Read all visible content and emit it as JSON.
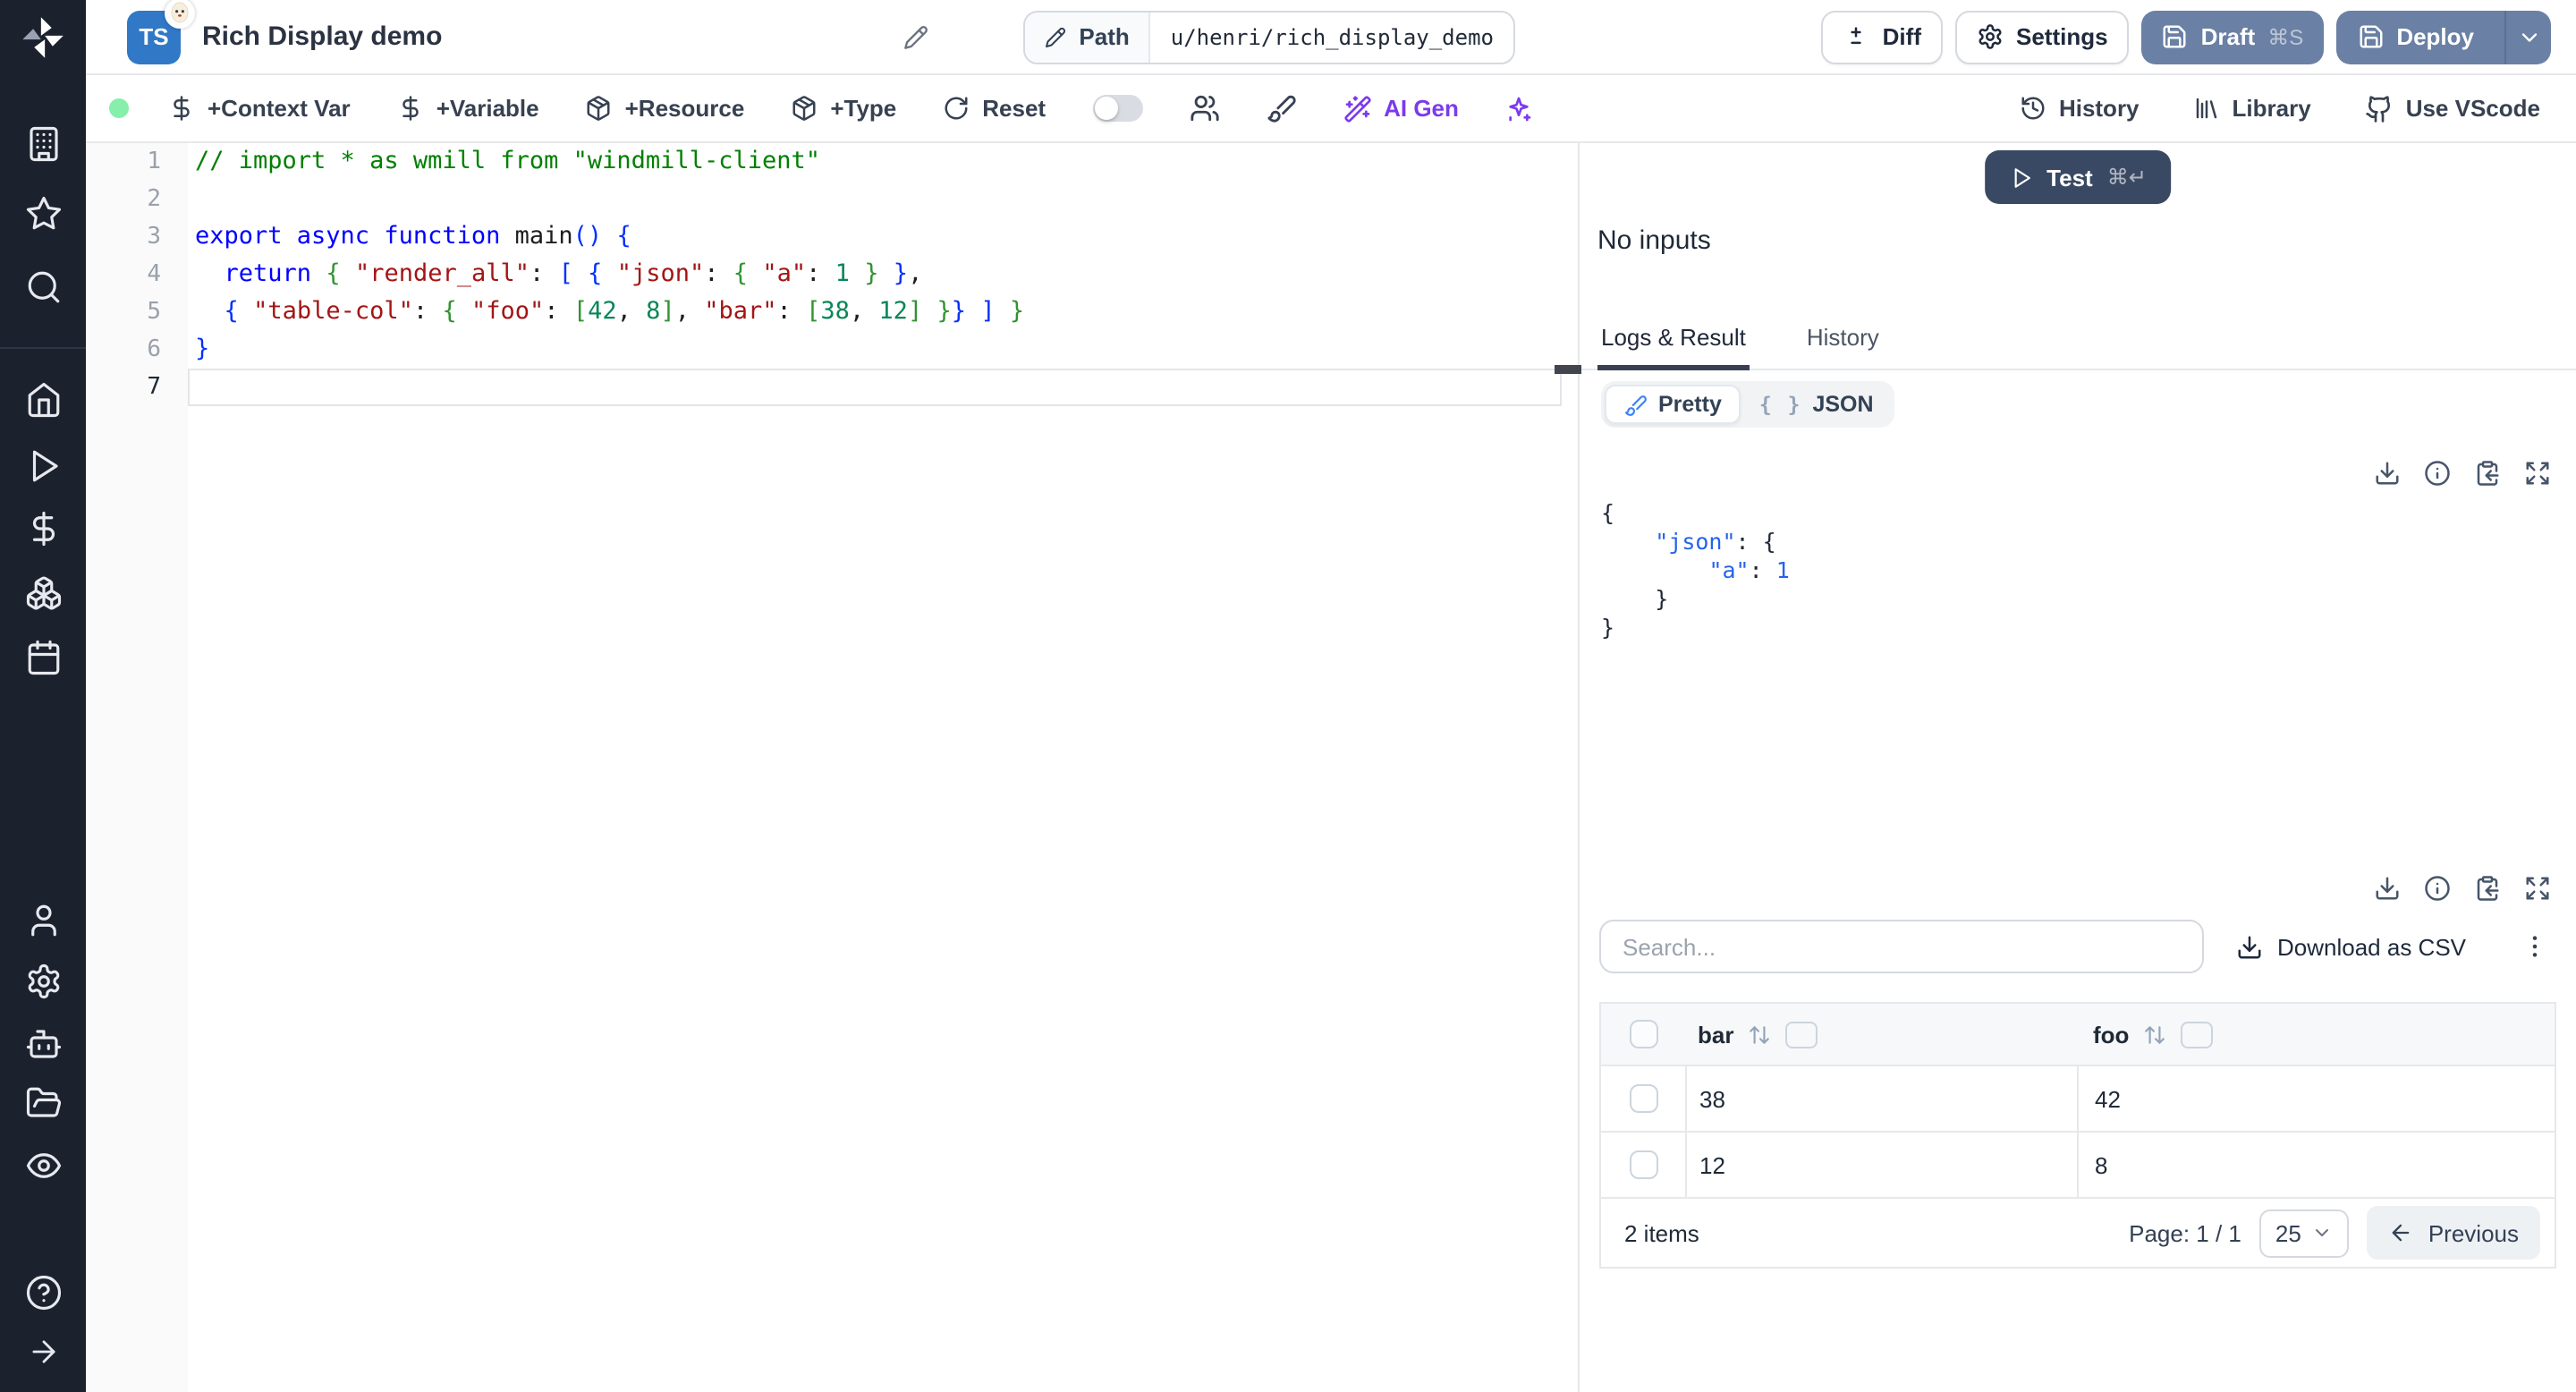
{
  "sidebar": {
    "icons": [
      "windmill-logo",
      "building",
      "star",
      "search",
      "home",
      "play",
      "dollar",
      "boxes",
      "calendar",
      "user",
      "settings",
      "bot",
      "folder-open",
      "eye",
      "help",
      "arrow-right"
    ]
  },
  "header": {
    "ts_badge": "TS",
    "title": "Rich Display demo",
    "path_label": "Path",
    "path_value": "u/henri/rich_display_demo",
    "diff_label": "Diff",
    "settings_label": "Settings",
    "draft_label": "Draft",
    "draft_shortcut": "⌘S",
    "deploy_label": "Deploy"
  },
  "toolbar": {
    "context_var_label": "+Context Var",
    "variable_label": "+Variable",
    "resource_label": "+Resource",
    "type_label": "+Type",
    "reset_label": "Reset",
    "ai_gen_label": "AI Gen",
    "history_label": "History",
    "library_label": "Library",
    "vscode_label": "Use VScode"
  },
  "editor": {
    "line_numbers": [
      "1",
      "2",
      "3",
      "4",
      "5",
      "6",
      "7"
    ],
    "active_line": 7,
    "lines": [
      [
        [
          "c",
          "// import * as wmill from \"windmill-client\""
        ]
      ],
      [],
      [
        [
          "k",
          "export async function"
        ],
        [
          "d",
          " main"
        ],
        [
          "b",
          "()"
        ],
        [
          "d",
          " "
        ],
        [
          "b",
          "{"
        ]
      ],
      [
        [
          "d",
          "  "
        ],
        [
          "k",
          "return"
        ],
        [
          "d",
          " "
        ],
        [
          "g",
          "{"
        ],
        [
          "d",
          " "
        ],
        [
          "s",
          "\"render_all\""
        ],
        [
          "d",
          ": "
        ],
        [
          "b",
          "["
        ],
        [
          "d",
          " "
        ],
        [
          "b",
          "{"
        ],
        [
          "d",
          " "
        ],
        [
          "s",
          "\"json\""
        ],
        [
          "d",
          ": "
        ],
        [
          "g",
          "{"
        ],
        [
          "d",
          " "
        ],
        [
          "s",
          "\"a\""
        ],
        [
          "d",
          ": "
        ],
        [
          "n",
          "1"
        ],
        [
          "d",
          " "
        ],
        [
          "g",
          "}"
        ],
        [
          "d",
          " "
        ],
        [
          "b",
          "}"
        ],
        [
          "d",
          ","
        ]
      ],
      [
        [
          "d",
          "  "
        ],
        [
          "b",
          "{"
        ],
        [
          "d",
          " "
        ],
        [
          "s",
          "\"table-col\""
        ],
        [
          "d",
          ": "
        ],
        [
          "g",
          "{"
        ],
        [
          "d",
          " "
        ],
        [
          "s",
          "\"foo\""
        ],
        [
          "d",
          ": "
        ],
        [
          "g",
          "["
        ],
        [
          "n",
          "42"
        ],
        [
          "d",
          ", "
        ],
        [
          "n",
          "8"
        ],
        [
          "g",
          "]"
        ],
        [
          "d",
          ", "
        ],
        [
          "s",
          "\"bar\""
        ],
        [
          "d",
          ": "
        ],
        [
          "g",
          "["
        ],
        [
          "n",
          "38"
        ],
        [
          "d",
          ", "
        ],
        [
          "n",
          "12"
        ],
        [
          "g",
          "]"
        ],
        [
          "d",
          " "
        ],
        [
          "g",
          "}"
        ],
        [
          "b",
          "}"
        ],
        [
          "d",
          " "
        ],
        [
          "b",
          "]"
        ],
        [
          "d",
          " "
        ],
        [
          "g",
          "}"
        ]
      ],
      [
        [
          "b",
          "}"
        ]
      ],
      []
    ]
  },
  "run_panel": {
    "test_label": "Test",
    "test_shortcut": "⌘↵",
    "no_inputs": "No inputs"
  },
  "tabs": {
    "logs_result": "Logs & Result",
    "history": "History"
  },
  "result": {
    "pretty_label": "Pretty",
    "json_label": "JSON",
    "braces_glyph": "{ }",
    "output_lines": [
      [
        [
          "p",
          "{"
        ]
      ],
      [
        [
          "p",
          "    "
        ],
        [
          "k",
          "\"json\""
        ],
        [
          "p",
          ": {"
        ]
      ],
      [
        [
          "p",
          "        "
        ],
        [
          "k",
          "\"a\""
        ],
        [
          "p",
          ": "
        ],
        [
          "n",
          "1"
        ]
      ],
      [
        [
          "p",
          "    }"
        ]
      ],
      [
        [
          "p",
          "}"
        ]
      ]
    ],
    "search_placeholder": "Search...",
    "download_csv_label": "Download as CSV"
  },
  "table": {
    "columns": [
      "bar",
      "foo"
    ],
    "rows": [
      [
        "38",
        "42"
      ],
      [
        "12",
        "8"
      ]
    ],
    "items_label": "2 items",
    "page_label": "Page: 1 / 1",
    "page_size": "25",
    "previous_label": "Previous"
  },
  "colors": {
    "accent_button": "#6a80a4",
    "test_button": "#3a4963",
    "ai_accent": "#7c3aed",
    "status_dot": "#86efac",
    "tab_underline": "#374151",
    "sidebar_bg": "#1c212e"
  }
}
